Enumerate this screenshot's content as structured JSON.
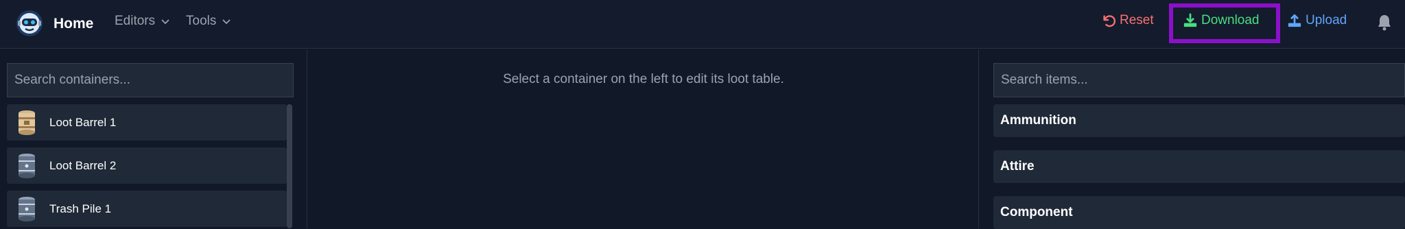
{
  "navbar": {
    "title": "Home",
    "menus": [
      {
        "label": "Editors",
        "icon": "chevron-down-icon"
      },
      {
        "label": "Tools",
        "icon": "chevron-down-icon"
      }
    ],
    "actions": {
      "reset": {
        "label": "Reset",
        "icon": "undo-icon",
        "color": "#f87171"
      },
      "download": {
        "label": "Download",
        "icon": "download-icon",
        "color": "#4ade80"
      },
      "upload": {
        "label": "Upload",
        "icon": "upload-icon",
        "color": "#60a5fa"
      }
    },
    "notifications_icon": "bell-icon"
  },
  "containers": {
    "search_placeholder": "Search containers...",
    "items": [
      {
        "name": "Loot Barrel 1",
        "icon": "wooden-barrel-icon"
      },
      {
        "name": "Loot Barrel 2",
        "icon": "blue-barrel-icon"
      },
      {
        "name": "Trash Pile 1",
        "icon": "blue-barrel-icon"
      }
    ]
  },
  "editor": {
    "empty_message": "Select a container on the left to edit its loot table."
  },
  "items": {
    "search_placeholder": "Search items...",
    "categories": [
      {
        "label": "Ammunition"
      },
      {
        "label": "Attire"
      },
      {
        "label": "Component"
      }
    ]
  },
  "colors": {
    "background": "#111827",
    "panel": "#1f2937",
    "highlight_box": "#8b10c9"
  }
}
